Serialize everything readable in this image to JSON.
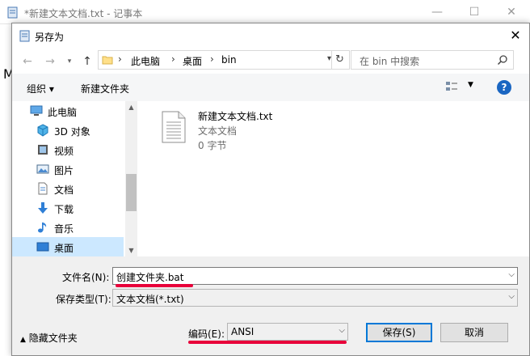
{
  "notepad": {
    "title": "*新建文本文档.txt - 记事本",
    "content_char": "M"
  },
  "dialog": {
    "title": "另存为",
    "address": {
      "crumbs": [
        "此电脑",
        "桌面",
        "bin"
      ]
    },
    "search": {
      "placeholder": "在 bin 中搜索"
    },
    "toolbar": {
      "organize": "组织 ▾",
      "new_folder": "新建文件夹",
      "help": "?"
    },
    "nav_items": [
      {
        "label": "此电脑",
        "icon": "computer-icon"
      },
      {
        "label": "3D 对象",
        "icon": "cube-icon"
      },
      {
        "label": "视频",
        "icon": "video-icon"
      },
      {
        "label": "图片",
        "icon": "picture-icon"
      },
      {
        "label": "文档",
        "icon": "document-icon"
      },
      {
        "label": "下载",
        "icon": "download-icon"
      },
      {
        "label": "音乐",
        "icon": "music-icon"
      },
      {
        "label": "桌面",
        "icon": "desktop-icon",
        "selected": true
      }
    ],
    "file": {
      "name": "新建文本文档.txt",
      "type": "文本文档",
      "size": "0 字节"
    },
    "form": {
      "filename_label": "文件名(N):",
      "filename_value": "创建文件夹.bat",
      "savetype_label": "保存类型(T):",
      "savetype_value": "文本文档(*.txt)",
      "encoding_label": "编码(E):",
      "encoding_value": "ANSI",
      "hide_folders": "隐藏文件夹",
      "save_button": "保存(S)",
      "cancel_button": "取消"
    },
    "highlight_color": "#e8003a"
  }
}
